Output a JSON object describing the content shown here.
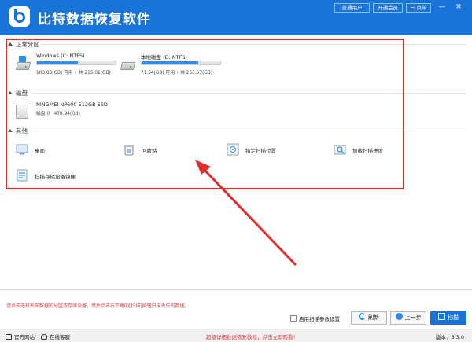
{
  "app": {
    "title": "比特数据恢复软件",
    "header_buttons": [
      "普通用户",
      "开通会员",
      "菜单"
    ],
    "window_controls": [
      "—",
      "✕"
    ]
  },
  "sections": {
    "partitions": {
      "title": "正常分区",
      "drives": [
        {
          "name": "Windows (C: NTFS)",
          "info": "103.83(GB) 可用 • 共 215.01(GB)",
          "used_fraction": 0.52
        },
        {
          "name": "本地磁盘 (D: NTFS)",
          "info": "71.54(GB) 可用 • 共 253.57(GB)",
          "used_fraction": 0.72
        }
      ]
    },
    "disks": {
      "title": "磁盘",
      "items": [
        {
          "name": "NINGMEI NP600 512GB SSD",
          "sub": "磁盘 0",
          "size": "476.94(GB)"
        }
      ]
    },
    "other": {
      "title": "其他",
      "items": [
        {
          "label": "桌面",
          "icon": "desktop-icon"
        },
        {
          "label": "回收站",
          "icon": "recycle-bin-icon"
        },
        {
          "label": "指定扫描位置",
          "icon": "target-location-icon"
        },
        {
          "label": "加载扫描进度",
          "icon": "load-progress-icon"
        },
        {
          "label": "扫描存储设备镜像",
          "icon": "device-image-icon"
        }
      ]
    }
  },
  "footer": {
    "hint": "请点击选择丢失数据的分区或存储设备，然后点击右下角的[扫描]按钮扫描丢失的数据。",
    "checkbox_label": "启用扫描参数设置",
    "buttons": {
      "refresh": "刷新",
      "back": "上一步",
      "scan": "扫描"
    }
  },
  "statusbar": {
    "website": "官方网站",
    "support": "在线客服",
    "promo": "超级详细数据恢复教程，点击立即观看！",
    "version": "版本：8.3.0"
  },
  "colors": {
    "brand": "#1a74d8",
    "highlight_box": "#e22c2c",
    "hint_text": "#e03b3b"
  }
}
